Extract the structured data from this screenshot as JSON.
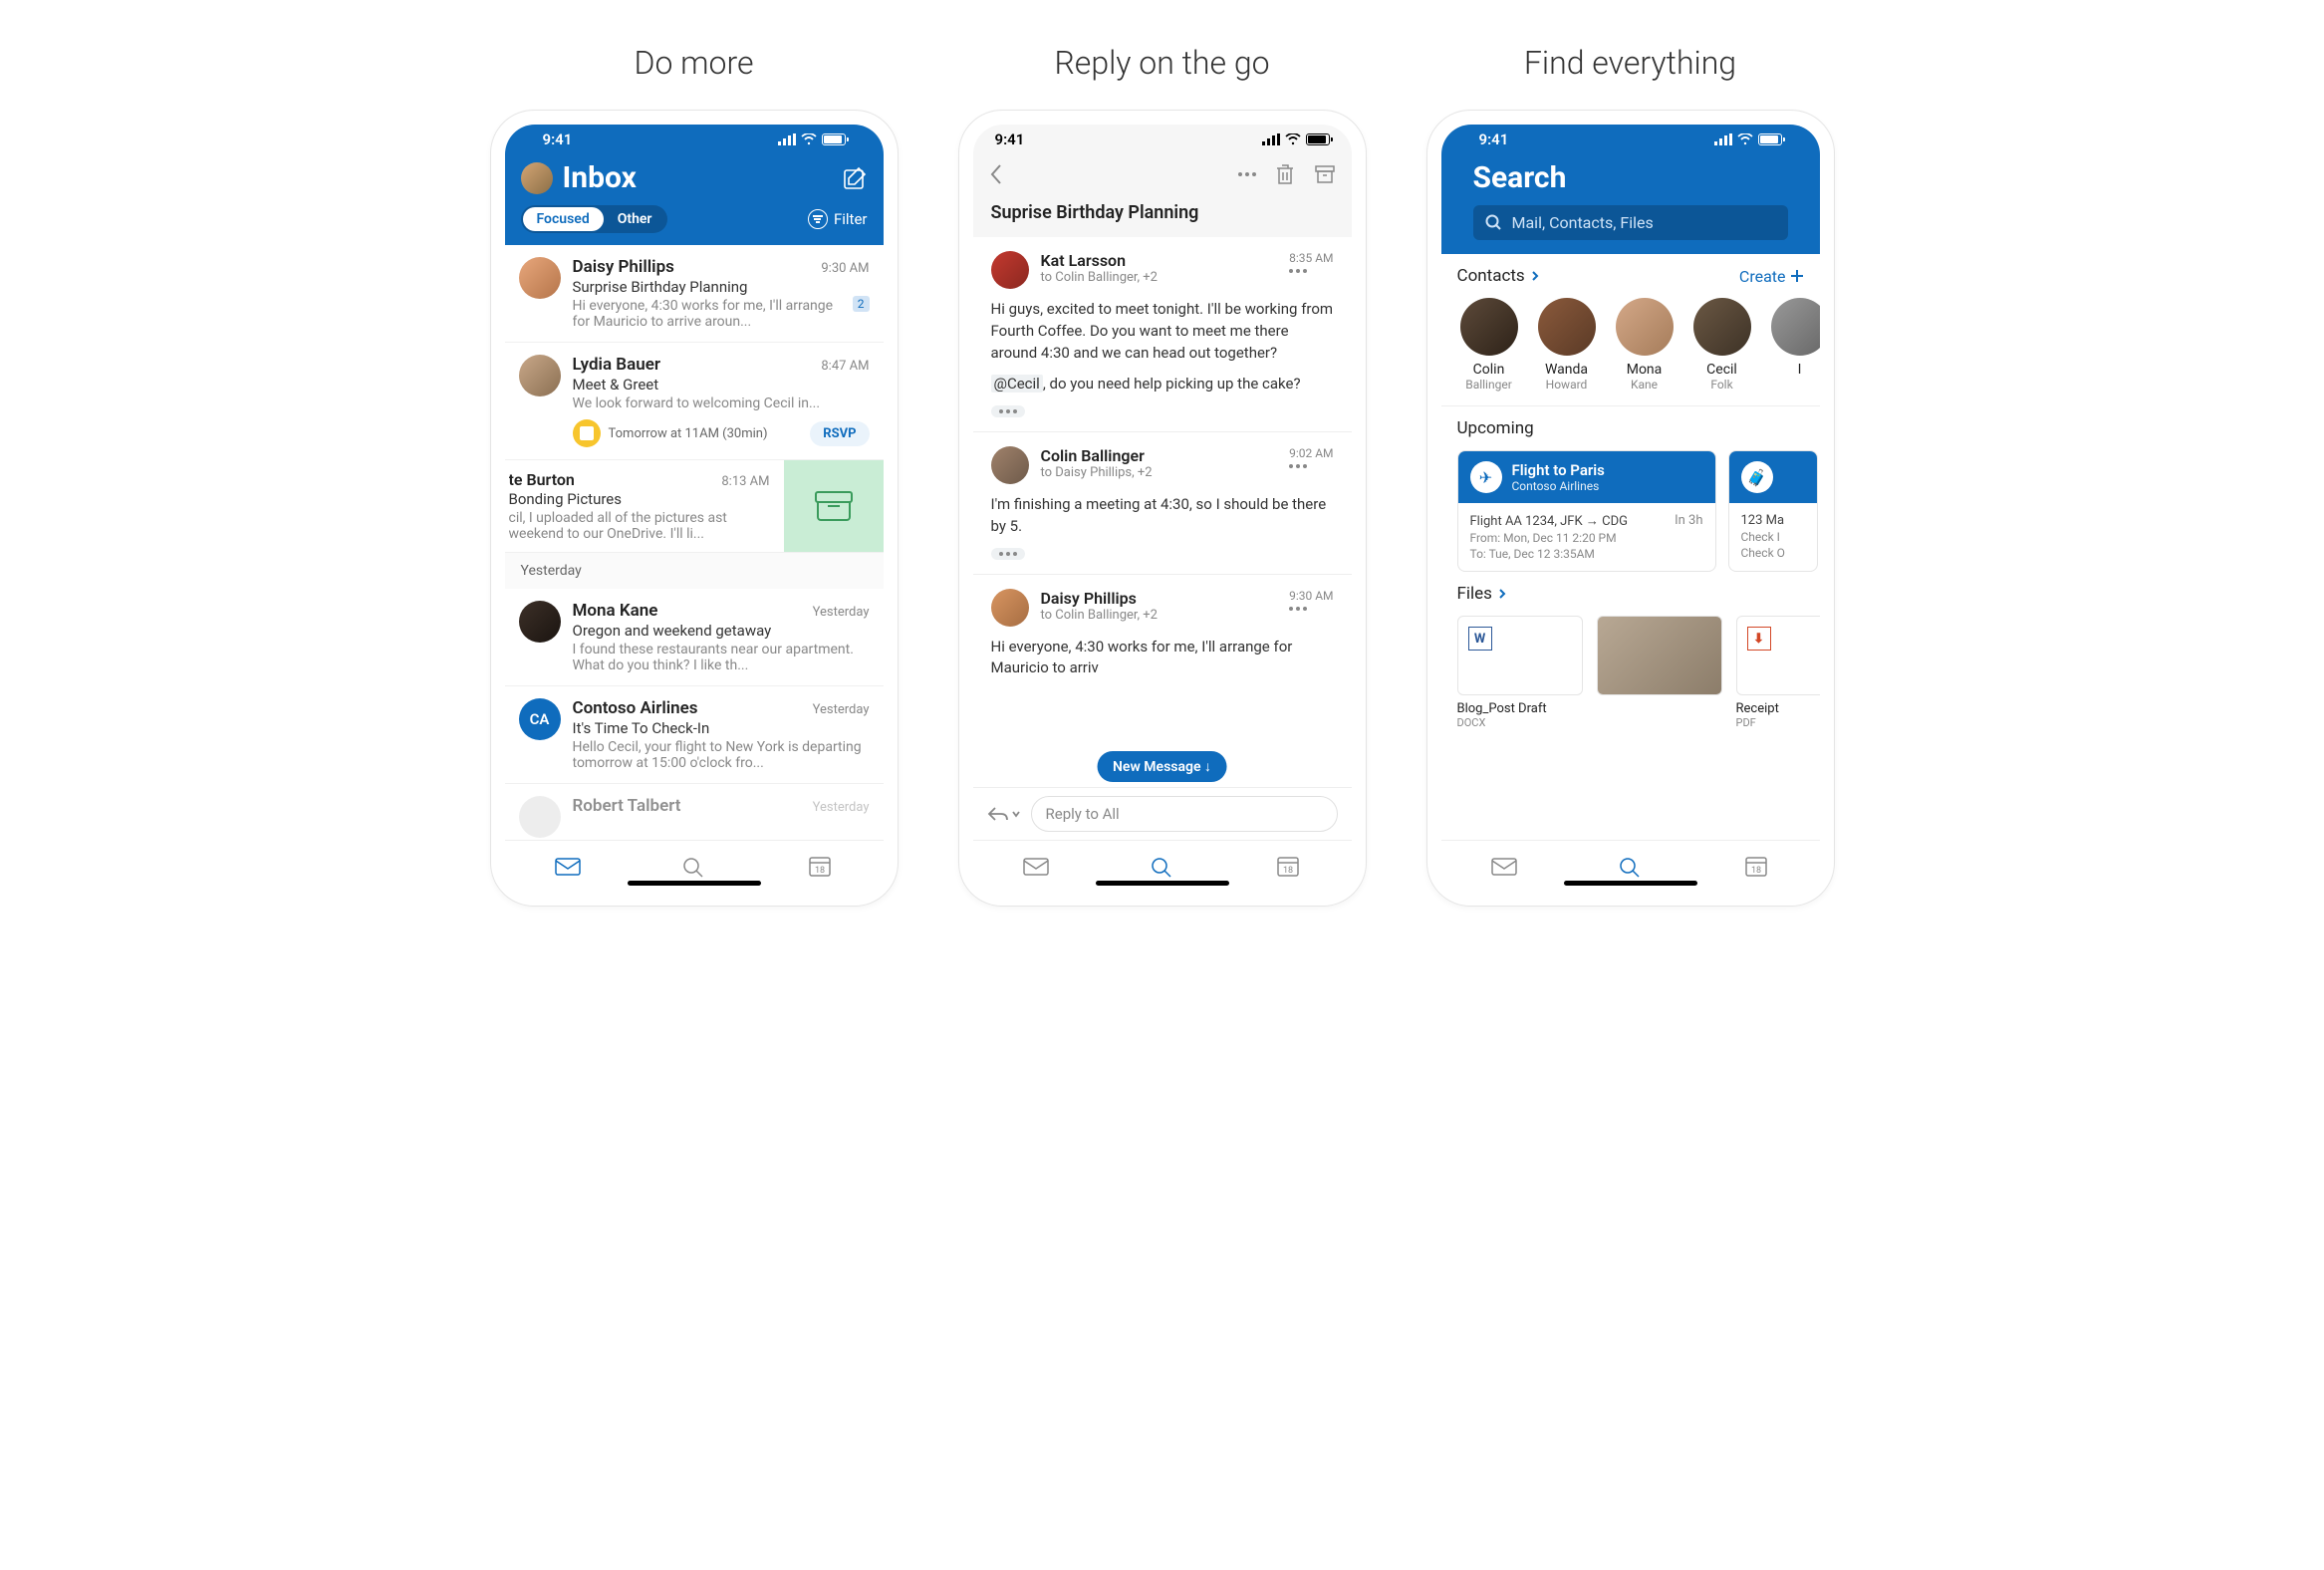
{
  "panels": {
    "p1_title": "Do more",
    "p2_title": "Reply on the go",
    "p3_title": "Find everything"
  },
  "status_time": "9:41",
  "inbox": {
    "title": "Inbox",
    "pill_focused": "Focused",
    "pill_other": "Other",
    "filter": "Filter",
    "emails": [
      {
        "sender": "Daisy Phillips",
        "time": "9:30 AM",
        "subject": "Surprise Birthday Planning",
        "preview": "Hi everyone, 4:30 works for me, I'll arrange for Mauricio to arrive aroun...",
        "count": "2"
      },
      {
        "sender": "Lydia Bauer",
        "time": "8:47 AM",
        "subject": "Meet & Greet",
        "preview": "We look forward to welcoming Cecil in...",
        "rsvp_time": "Tomorrow at 11AM (30min)",
        "rsvp_btn": "RSVP"
      }
    ],
    "swiped": {
      "sender": "te Burton",
      "time": "8:13 AM",
      "subject": "Bonding Pictures",
      "preview": "cil, I uploaded all of the pictures ast weekend to our OneDrive. I'll li..."
    },
    "section_yesterday": "Yesterday",
    "yesterday": [
      {
        "sender": "Mona Kane",
        "time": "Yesterday",
        "subject": "Oregon and weekend getaway",
        "preview": "I found these restaurants near our apartment. What do you think? I like th..."
      },
      {
        "sender": "Contoso Airlines",
        "initials": "CA",
        "time": "Yesterday",
        "subject": "It's Time To Check-In",
        "preview": "Hello Cecil, your flight to New York is departing tomorrow at 15:00 o'clock fro..."
      },
      {
        "sender": "Robert Talbert",
        "time": "Yesterday"
      }
    ],
    "nav_date": "18"
  },
  "thread": {
    "subject": "Suprise Birthday Planning",
    "messages": [
      {
        "from": "Kat Larsson",
        "to": "to Colin Ballinger, +2",
        "time": "8:35 AM",
        "body": "Hi guys, excited to meet tonight. I'll be working from Fourth Coffee. Do you want to meet me there around 4:30 and we can head out together?",
        "body2": "@Cecil, do you need help picking up the cake?",
        "mention": "@Cecil"
      },
      {
        "from": "Colin Ballinger",
        "to": "to Daisy Phillips, +2",
        "time": "9:02 AM",
        "body": "I'm finishing a meeting at 4:30, so I should be there by 5."
      },
      {
        "from": "Daisy Phillips",
        "to": "to Colin Ballinger, +2",
        "time": "9:30 AM",
        "body": "Hi everyone, 4:30 works for me, I'll arrange for Mauricio to arriv"
      }
    ],
    "new_message_pill": "New Message  ↓",
    "reply_placeholder": "Reply to All"
  },
  "search": {
    "title": "Search",
    "placeholder": "Mail, Contacts, Files",
    "contacts_label": "Contacts",
    "create_label": "Create",
    "contacts": [
      {
        "first": "Colin",
        "last": "Ballinger"
      },
      {
        "first": "Wanda",
        "last": "Howard"
      },
      {
        "first": "Mona",
        "last": "Kane"
      },
      {
        "first": "Cecil",
        "last": "Folk"
      },
      {
        "first": "I",
        "last": ""
      }
    ],
    "upcoming_label": "Upcoming",
    "flight_card": {
      "title": "Flight to Paris",
      "sub": "Contoso Airlines",
      "line": "Flight AA 1234, JFK → CDG",
      "eta": "In 3h",
      "from": "From: Mon, Dec 11 2:20 PM",
      "to": "To: Tue, Dec 12 3:35AM"
    },
    "hotel_card": {
      "line": "123 Ma",
      "checkin": "Check I",
      "checkout": "Check O"
    },
    "files_label": "Files",
    "files": [
      {
        "name": "Blog_Post Draft",
        "type": "DOCX",
        "glyph": "W",
        "kind": "word"
      },
      {
        "name": "",
        "type": "",
        "kind": "img"
      },
      {
        "name": "Receipt",
        "type": "PDF",
        "glyph": "",
        "kind": "pdf"
      }
    ]
  }
}
